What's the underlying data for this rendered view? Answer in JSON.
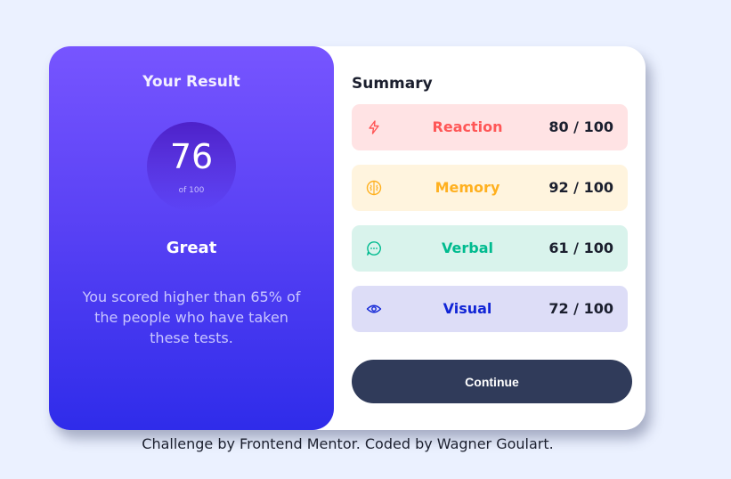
{
  "result": {
    "title": "Your Result",
    "score": "76",
    "score_of": "of 100",
    "grade": "Great",
    "description": "You scored higher than 65% of the people who have taken these tests."
  },
  "summary": {
    "title": "Summary",
    "items": [
      {
        "label": "Reaction",
        "value": "80 / 100",
        "icon": "lightning-icon",
        "color": "#ff5757"
      },
      {
        "label": "Memory",
        "value": "92 / 100",
        "icon": "brain-icon",
        "color": "#ffb01f"
      },
      {
        "label": "Verbal",
        "value": "61 / 100",
        "icon": "chat-bubble-icon",
        "color": "#00bb8f"
      },
      {
        "label": "Visual",
        "value": "72 / 100",
        "icon": "eye-icon",
        "color": "#1125d6"
      }
    ],
    "continue_label": "Continue"
  },
  "footer": {
    "text": "Challenge by Frontend Mentor. Coded by Wagner Goulart."
  },
  "colors": {
    "background": "#ebf1ff",
    "gradient_top": "#7755ff",
    "gradient_bottom": "#2f2cea",
    "button": "#303b5a"
  }
}
